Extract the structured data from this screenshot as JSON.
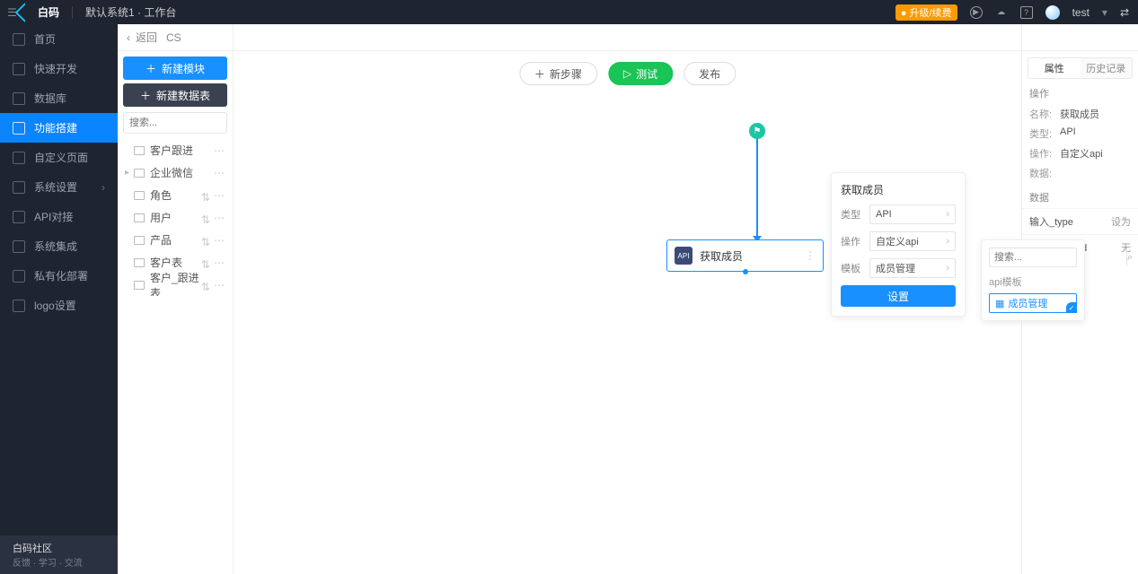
{
  "top": {
    "brand": "白码",
    "title": "默认系统1 · 工作台",
    "upgrade": "● 升级/续费",
    "user": "test"
  },
  "sidebar": {
    "items": [
      {
        "label": "首页"
      },
      {
        "label": "快速开发"
      },
      {
        "label": "数据库"
      },
      {
        "label": "功能搭建"
      },
      {
        "label": "自定义页面"
      },
      {
        "label": "系统设置"
      },
      {
        "label": "API对接"
      },
      {
        "label": "系统集成"
      },
      {
        "label": "私有化部署"
      },
      {
        "label": "logo设置"
      }
    ],
    "footer_title": "白码社区",
    "footer_sub": "反馈 · 学习 · 交流"
  },
  "breadcrumb": {
    "back": "返回",
    "name": "CS"
  },
  "col2": {
    "new_module": "新建模块",
    "new_table": "新建数据表",
    "search_ph": "搜索...",
    "tree": [
      {
        "type": "folder",
        "label": "客户跟进"
      },
      {
        "type": "folder",
        "label": "企业微信",
        "caret": true
      },
      {
        "type": "leaf",
        "label": "角色"
      },
      {
        "type": "leaf",
        "label": "用户"
      },
      {
        "type": "leaf",
        "label": "产品"
      },
      {
        "type": "leaf",
        "label": "客户表"
      },
      {
        "type": "leaf",
        "label": "客户_跟进表"
      }
    ]
  },
  "toolbar": {
    "new_step": "新步骤",
    "test": "测试",
    "publish": "发布"
  },
  "node": {
    "label": "获取成员",
    "badge": "API"
  },
  "panel": {
    "title": "获取成员",
    "rows": [
      {
        "label": "类型",
        "value": "API"
      },
      {
        "label": "操作",
        "value": "自定义api"
      },
      {
        "label": "模板",
        "value": "成员管理"
      }
    ],
    "set": "设置"
  },
  "popup": {
    "search_ph": "搜索...",
    "group": "api模板",
    "option": "成员管理"
  },
  "right": {
    "tabs": [
      "属性",
      "历史记录"
    ],
    "op_header": "操作",
    "kv": [
      {
        "k": "名称:",
        "v": "获取成员"
      },
      {
        "k": "类型:",
        "v": "API"
      },
      {
        "k": "操作:",
        "v": "自定义api"
      },
      {
        "k": "数据:",
        "v": ""
      }
    ],
    "data_header": "数据",
    "rows": [
      {
        "k": "输入_type",
        "v": "设为"
      },
      {
        "k": "输入_user_id",
        "v": "无"
      }
    ]
  }
}
